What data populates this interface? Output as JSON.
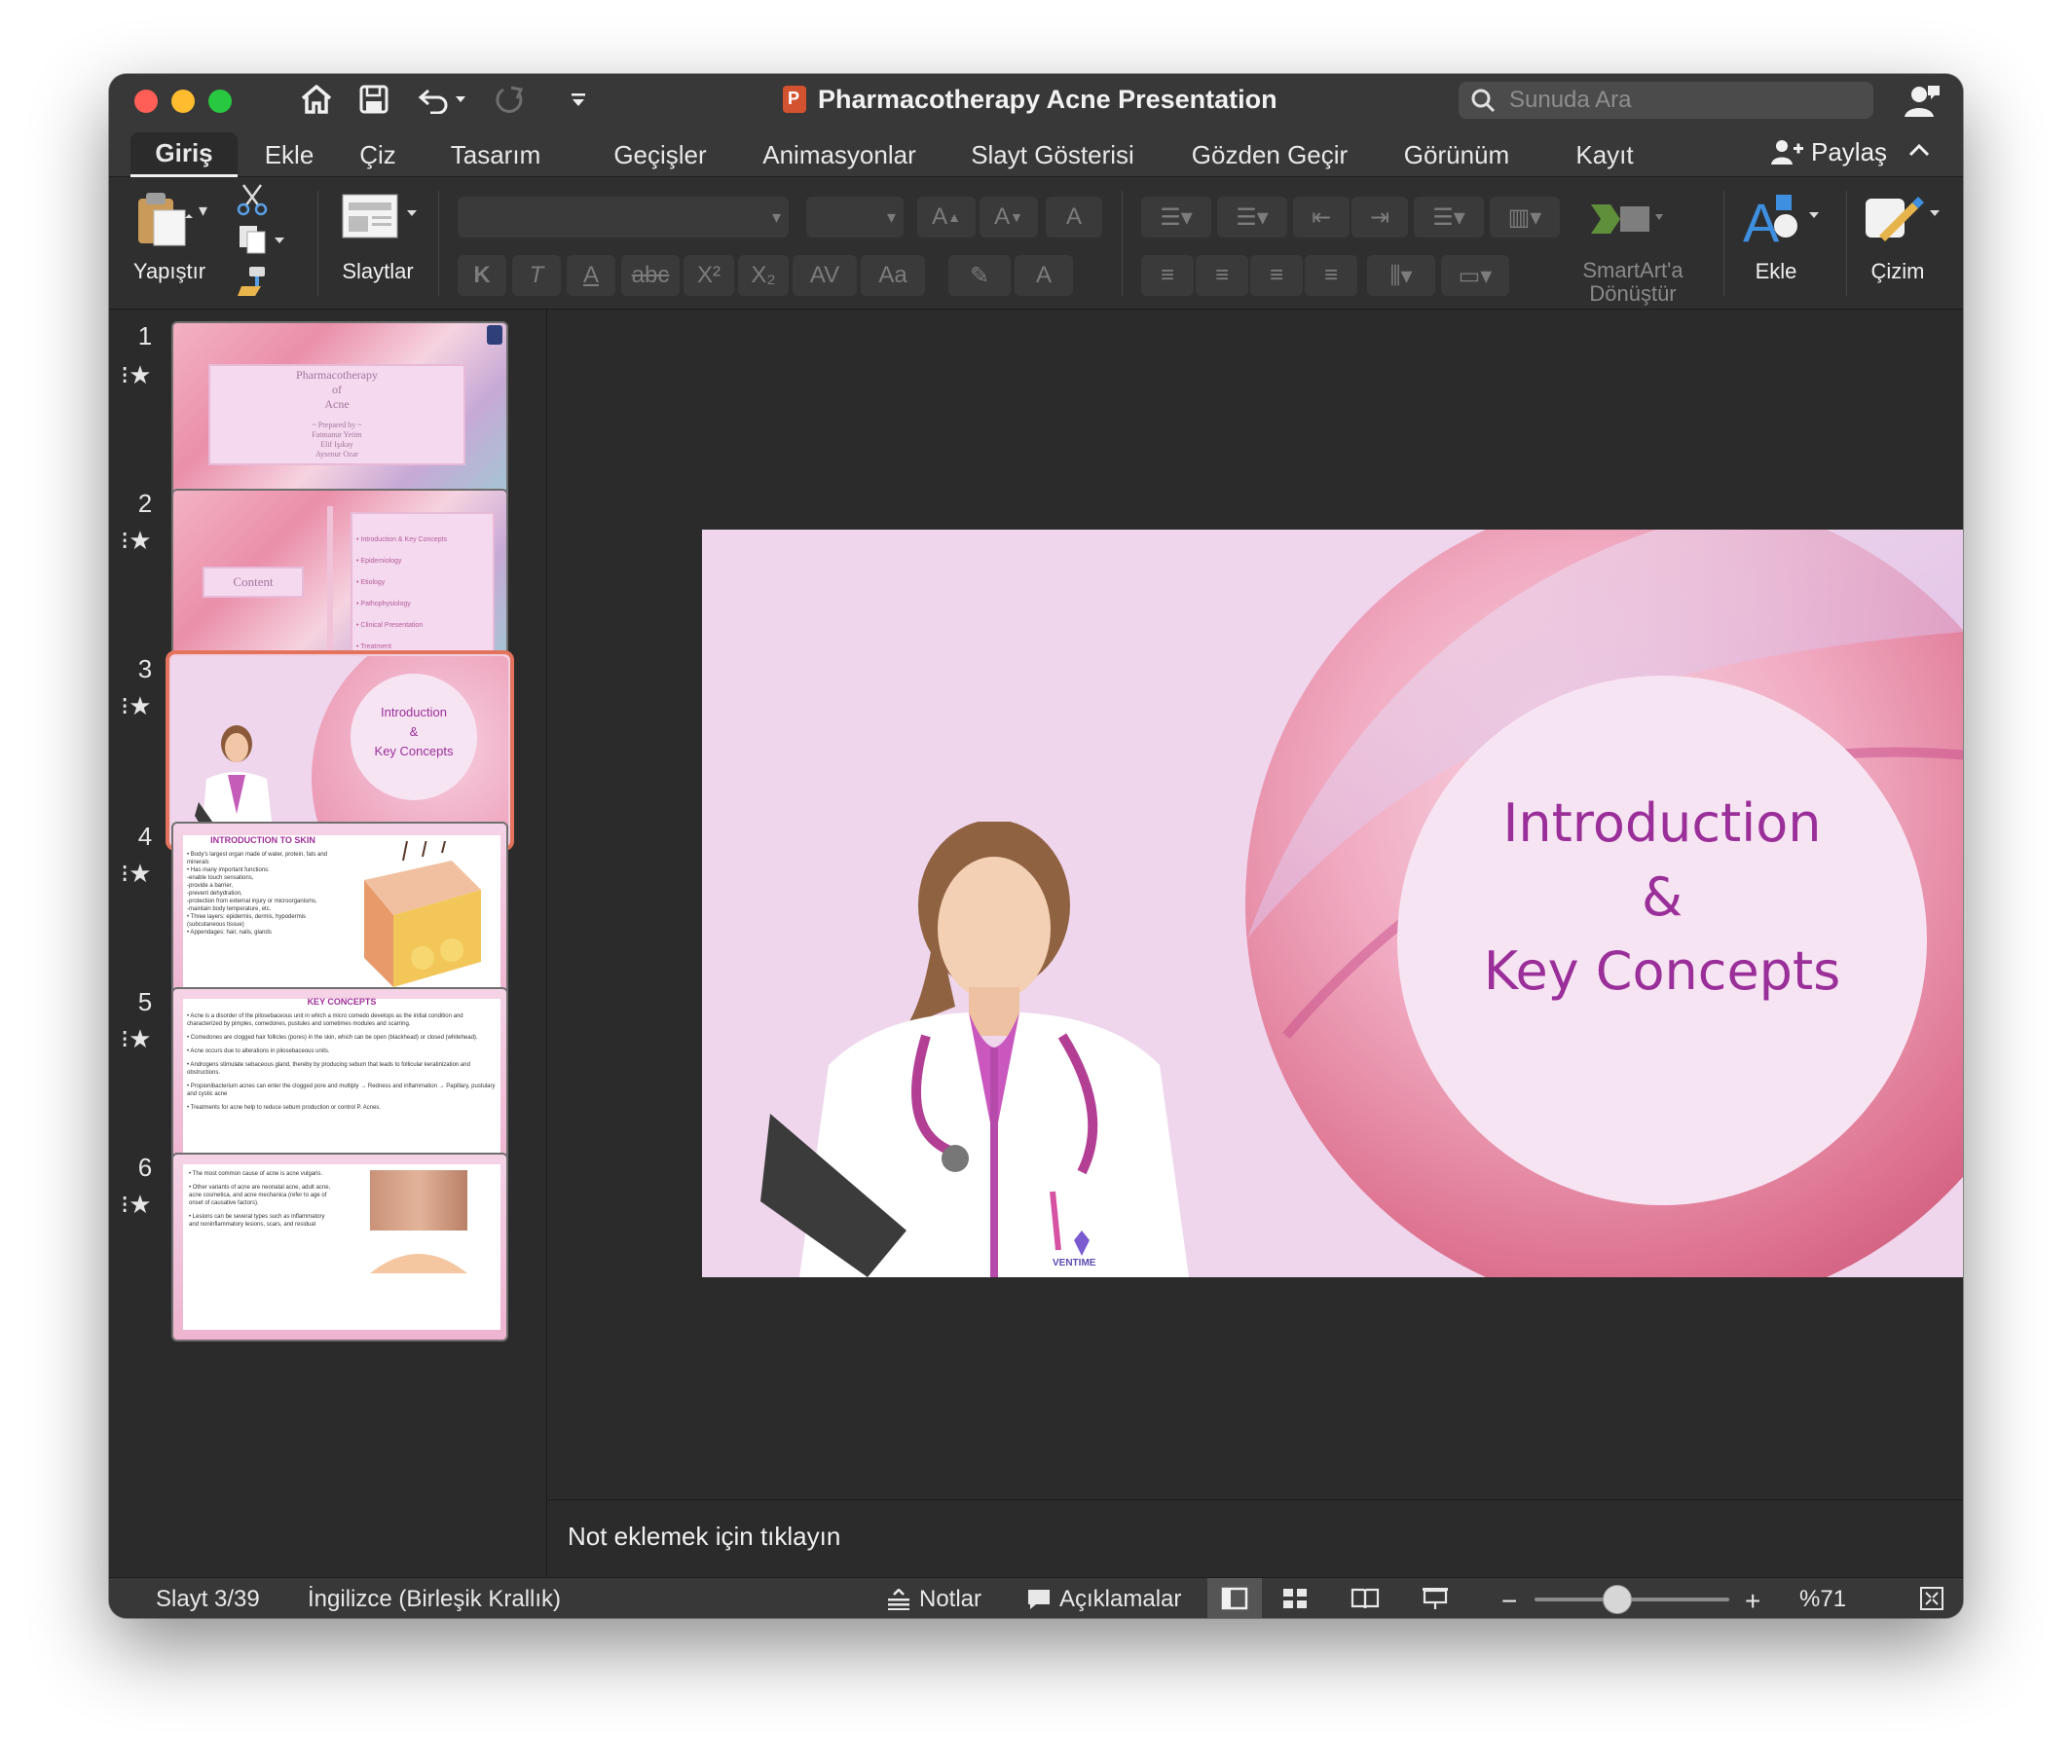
{
  "window": {
    "title": "Pharmacotherapy Acne Presentation",
    "search_placeholder": "Sunuda Ara"
  },
  "tabs": [
    "Giriş",
    "Ekle",
    "Çiz",
    "Tasarım",
    "Geçişler",
    "Animasyonlar",
    "Slayt Gösterisi",
    "Gözden Geçir",
    "Görünüm",
    "Kayıt"
  ],
  "share_label": "Paylaş",
  "ribbon": {
    "paste_label": "Yapıştır",
    "slides_label": "Slaytlar",
    "smartart_line1": "SmartArt'a",
    "smartart_line2": "Dönüştür",
    "insert_label": "Ekle",
    "draw_label": "Çizim",
    "font_format_glyphs": [
      "K",
      "T",
      "A",
      "abc",
      "X²",
      "X₂",
      "AV",
      "Aa"
    ]
  },
  "thumbnails": {
    "s1": {
      "num": "1",
      "title_lines": [
        "Pharmacotherapy",
        "of",
        "Acne"
      ],
      "prepared_by": "~ Prepared by ~",
      "authors": [
        "Fatmanur Yetim",
        "Elif Işıkay",
        "Aysenur Ozar"
      ]
    },
    "s2": {
      "num": "2",
      "title": "Content",
      "items": [
        "Introduction & Key Concepts",
        "Epidemiology",
        "Etiology",
        "Pathophysiology",
        "Clinical Presentation",
        "Treatment"
      ]
    },
    "s3": {
      "num": "3",
      "lines": [
        "Introduction",
        "&",
        "Key Concepts"
      ]
    },
    "s4": {
      "num": "4",
      "heading": "INTRODUCTION TO SKIN",
      "lines": [
        "• Body's largest organ made of water, protein, fats and minerals",
        "• Has many important functions:",
        "-enable touch sensations,",
        "-provide a barrier,",
        "-prevent dehydration,",
        "-protection from external injury or microorganisms,",
        "-maintain body temperature, etc.",
        "• Three layers: epidermis, dermis, hypodermis (subcutaneous tissue)",
        "• Appendages: hair, nails, glands"
      ]
    },
    "s5": {
      "num": "5",
      "heading": "KEY CONCEPTS",
      "lines": [
        "• Acne is a disorder of the pilosebaceous unit in which a micro comedo develops as the initial condition and characterized by pimples, comedones, pustules and sometimes modules and scarring.",
        "• Comedones are clogged hair follicles (pores) in the skin, which can be open (blackhead) or closed (whitehead).",
        "• Acne occurs due to alterations in pilosebaceous units.",
        "• Androgens stimulate sebaceous gland, thereby by producing sebum that leads to follicular keratinization and obstructions.",
        "• Propionibacterium acnes can enter the clogged pore and multiply → Redness and inflammation → Papillary, pustulary and cystic acne",
        "• Treatments for acne help to reduce sebum production or control P. Acnes."
      ]
    },
    "s6": {
      "num": "6",
      "lines": [
        "• The most common cause of acne is acne vulgaris.",
        "• Other variants of acne are neonatal acne, adult acne, acne cosmetica, and acne mechanica (refer to age of onset of causative factors).",
        "• Lesions can be several types such as inflammatory and noninflammatory lesions, scars, and residual"
      ]
    }
  },
  "main_slide": {
    "lines": [
      "Introduction",
      "&",
      "Key Concepts"
    ],
    "badge": "VENTIME"
  },
  "notes_placeholder": "Not eklemek için tıklayın",
  "status": {
    "slide_counter": "Slayt 3/39",
    "language": "İngilizce (Birleşik Krallık)",
    "notes_label": "Notlar",
    "comments_label": "Açıklamalar",
    "zoom": "%71"
  },
  "colors": {
    "title_purple": "#9a2f99",
    "selection": "#e3735d",
    "slide_bg": "#efd6ec"
  }
}
